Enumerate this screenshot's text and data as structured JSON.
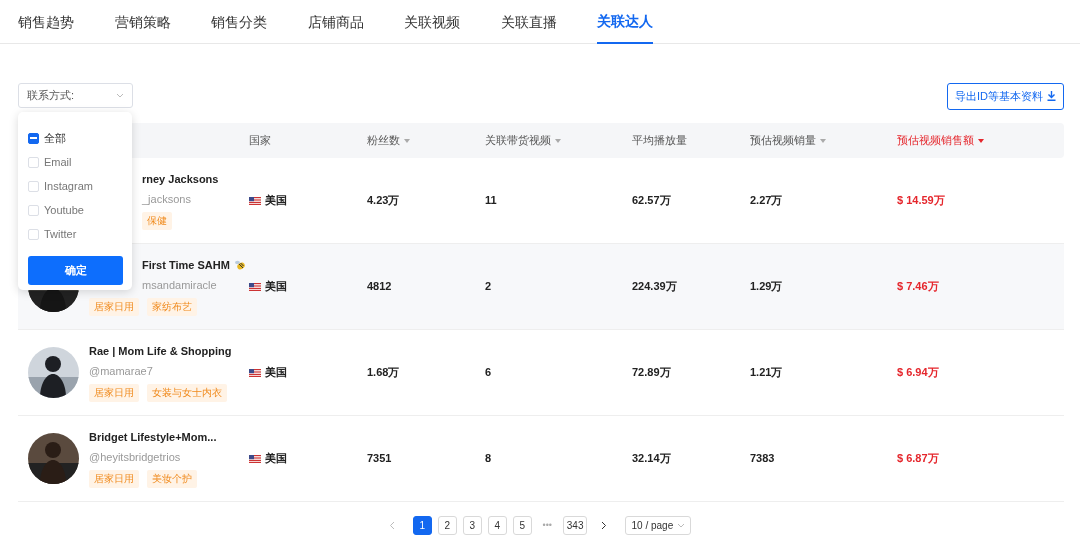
{
  "tabs": [
    {
      "label": "销售趋势",
      "selected": false
    },
    {
      "label": "营销策略",
      "selected": false
    },
    {
      "label": "销售分类",
      "selected": false
    },
    {
      "label": "店铺商品",
      "selected": false
    },
    {
      "label": "关联视频",
      "selected": false
    },
    {
      "label": "关联直播",
      "selected": false
    },
    {
      "label": "关联达人",
      "selected": true
    }
  ],
  "filter": {
    "label": "联系方式:",
    "expanded": true,
    "options": [
      {
        "label": "全部",
        "checked": false,
        "indeterminate": true
      },
      {
        "label": "Email",
        "checked": false,
        "indeterminate": false
      },
      {
        "label": "Instagram",
        "checked": false,
        "indeterminate": false
      },
      {
        "label": "Youtube",
        "checked": false,
        "indeterminate": false
      },
      {
        "label": "Twitter",
        "checked": false,
        "indeterminate": false
      }
    ],
    "confirm": "确定"
  },
  "export_button": "导出ID等基本资料",
  "table": {
    "columns": [
      {
        "label": "国家",
        "sortable": false,
        "sorted": false
      },
      {
        "label": "粉丝数",
        "sortable": true,
        "sorted": false
      },
      {
        "label": "关联带货视频",
        "sortable": true,
        "sorted": false
      },
      {
        "label": "平均播放量",
        "sortable": false,
        "sorted": false
      },
      {
        "label": "预估视频销量",
        "sortable": true,
        "sorted": false
      },
      {
        "label": "预估视频销售额",
        "sortable": true,
        "sorted": true
      }
    ],
    "rows": [
      {
        "name": "rney Jacksons",
        "handle": "_jacksons",
        "partly_hidden": true,
        "highlighted": false,
        "tags": [
          "保健"
        ],
        "country": "美国",
        "followers": "4.23万",
        "videos": "11",
        "avg_views": "62.57万",
        "est_sales": "2.27万",
        "est_revenue": "$ 14.59万"
      },
      {
        "name": "First Time SAHM",
        "badge": true,
        "handle": "msandamiracle",
        "partly_hidden": true,
        "highlighted": true,
        "tags": [
          "居家日用",
          "家纺布艺"
        ],
        "country": "美国",
        "followers": "4812",
        "videos": "2",
        "avg_views": "224.39万",
        "est_sales": "1.29万",
        "est_revenue": "$ 7.46万"
      },
      {
        "name": "Rae | Mom Life & Shopping",
        "handle": "@mamarae7",
        "partly_hidden": false,
        "highlighted": false,
        "tags": [
          "居家日用",
          "女装与女士内衣"
        ],
        "country": "美国",
        "followers": "1.68万",
        "videos": "6",
        "avg_views": "72.89万",
        "est_sales": "1.21万",
        "est_revenue": "$ 6.94万"
      },
      {
        "name": "Bridget Lifestyle+Mom...",
        "handle": "@heyitsbridgetrios",
        "partly_hidden": false,
        "highlighted": false,
        "tags": [
          "居家日用",
          "美妆个护"
        ],
        "country": "美国",
        "followers": "7351",
        "videos": "8",
        "avg_views": "32.14万",
        "est_sales": "7383",
        "est_revenue": "$ 6.87万"
      }
    ]
  },
  "pagination": {
    "pages": [
      {
        "label": "1",
        "selected": true
      },
      {
        "label": "2",
        "selected": false
      },
      {
        "label": "3",
        "selected": false
      },
      {
        "label": "4",
        "selected": false
      },
      {
        "label": "5",
        "selected": false
      }
    ],
    "ellipsis": "•••",
    "last_pages": [
      {
        "label": "343",
        "selected": false
      }
    ],
    "page_size": "10 / page"
  }
}
